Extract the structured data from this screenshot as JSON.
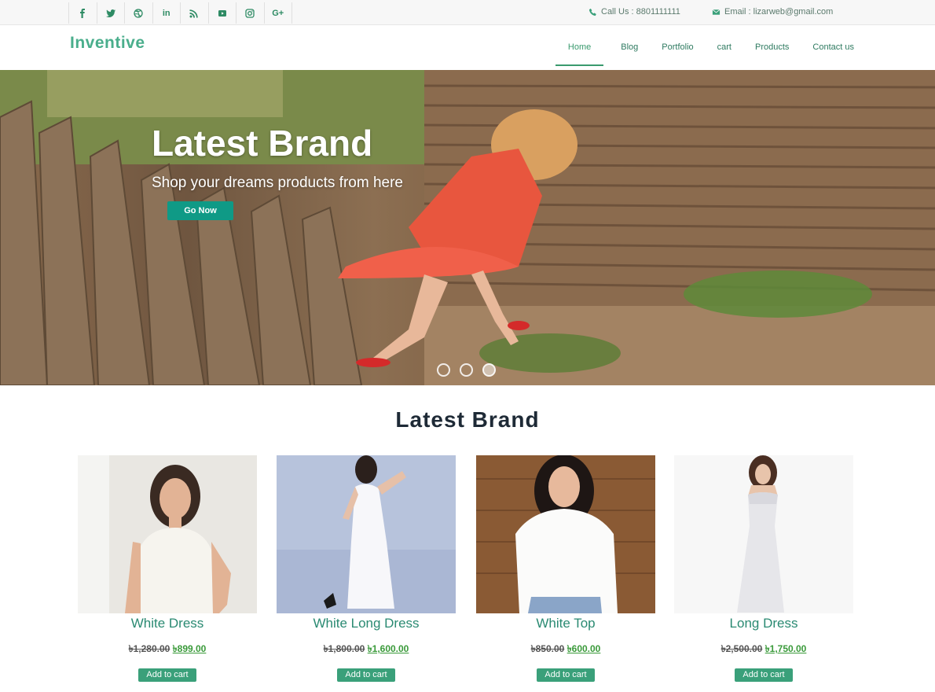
{
  "topbar": {
    "social": [
      {
        "icon": "facebook-icon",
        "glyph": "f"
      },
      {
        "icon": "twitter-icon",
        "glyph": "t"
      },
      {
        "icon": "dribbble-icon",
        "glyph": "d"
      },
      {
        "icon": "linkedin-icon",
        "glyph": "in"
      },
      {
        "icon": "rss-icon",
        "glyph": "r"
      },
      {
        "icon": "youtube-icon",
        "glyph": "y"
      },
      {
        "icon": "instagram-icon",
        "glyph": "i"
      },
      {
        "icon": "google-plus-icon",
        "glyph": "G+"
      }
    ],
    "phone": "Call Us : 8801111111",
    "email": "Email : lizarweb@gmail.com"
  },
  "header": {
    "logo": "Inventive",
    "nav": [
      "Home",
      "Blog",
      "Portfolio",
      "cart",
      "Products",
      "Contact us"
    ],
    "active_nav": "Home"
  },
  "hero": {
    "title": "Latest Brand",
    "subtitle": "Shop your dreams products from here",
    "button": "Go Now",
    "slides": 3,
    "active_slide": 3
  },
  "section": {
    "title": "Latest Brand"
  },
  "products": [
    {
      "name": "White Dress",
      "old_price": "৳1,280.00",
      "new_price": "৳899.00",
      "cart": "Add to cart"
    },
    {
      "name": "White Long Dress",
      "old_price": "৳1,800.00",
      "new_price": "৳1,600.00",
      "cart": "Add to cart"
    },
    {
      "name": "White Top",
      "old_price": "৳850.00",
      "new_price": "৳600.00",
      "cart": "Add to cart"
    },
    {
      "name": "Long Dress",
      "old_price": "৳2,500.00",
      "new_price": "৳1,750.00",
      "cart": "Add to cart"
    }
  ],
  "colors": {
    "accent": "#3aa07a",
    "button": "#0f9a86",
    "title": "#1e2a36"
  }
}
